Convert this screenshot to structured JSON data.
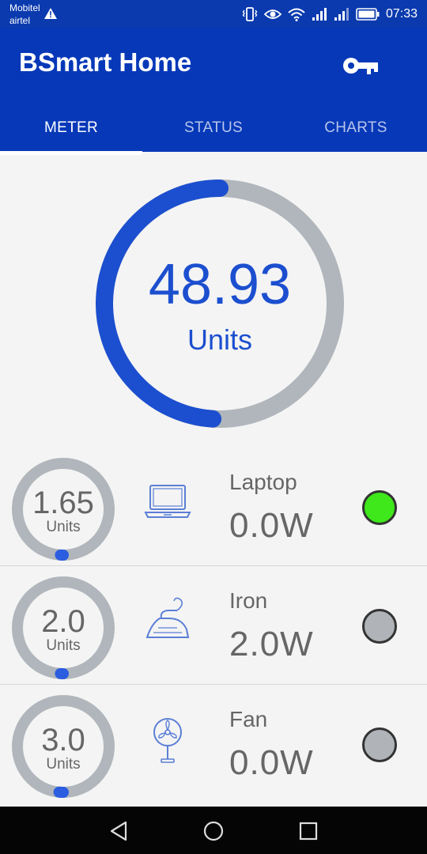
{
  "status_bar": {
    "carrier_1": "Mobitel",
    "carrier_2": "airtel",
    "time": "07:33",
    "icons": [
      "warning-icon",
      "vibrate-icon",
      "eye-icon",
      "wifi-icon",
      "signal-icon",
      "signal-icon",
      "battery-icon"
    ]
  },
  "app": {
    "title": "BSmart Home",
    "action_icon": "key-icon"
  },
  "tabs": [
    {
      "label": "METER",
      "active": true
    },
    {
      "label": "STATUS",
      "active": false
    },
    {
      "label": "CHARTS",
      "active": false
    }
  ],
  "meter": {
    "value": "48.93",
    "unit": "Units",
    "progress": 0.49
  },
  "devices": [
    {
      "name": "Laptop",
      "units": "1.65",
      "unit_label": "Units",
      "power": "0.0W",
      "icon": "laptop-icon",
      "status_color": "#3ee81a",
      "gauge_progress": 0.02
    },
    {
      "name": "Iron",
      "units": "2.0",
      "unit_label": "Units",
      "power": "2.0W",
      "icon": "iron-icon",
      "status_color": "#b0b4b8",
      "gauge_progress": 0.02
    },
    {
      "name": "Fan",
      "units": "3.0",
      "unit_label": "Units",
      "power": "0.0W",
      "icon": "fan-icon",
      "status_color": "#b0b4b8",
      "gauge_progress": 0.03
    }
  ],
  "colors": {
    "primary": "#0638b8",
    "accent": "#1c4fcf",
    "track": "#b0b6bb",
    "text": "#666666"
  },
  "nav": [
    "back-icon",
    "home-icon",
    "recents-icon"
  ]
}
